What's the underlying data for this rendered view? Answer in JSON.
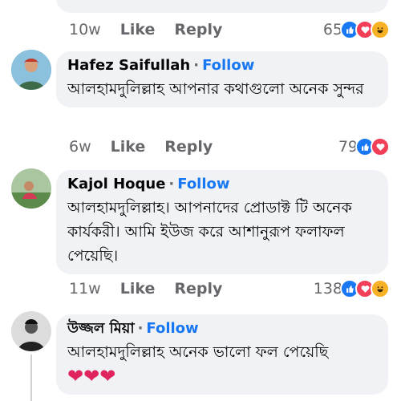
{
  "comments": [
    {
      "time": "10w",
      "like": "Like",
      "reply": "Reply",
      "count": "65"
    },
    {
      "author": "Hafez Saifullah",
      "follow": "Follow",
      "text": "আলহামদুলিল্লাহ আপনার কথাগুলো অনেক সুন্দর",
      "time": "6w",
      "like": "Like",
      "reply": "Reply",
      "count": "79"
    },
    {
      "author": "Kajol Hoque",
      "follow": "Follow",
      "text": "আলহামদুলিল্লাহ। আপনাদের প্রোডাক্ট টি অনেক কার্যকরী। আমি ইউজ করে আশানুরূপ ফলাফল পেয়েছি।",
      "time": "11w",
      "like": "Like",
      "reply": "Reply",
      "count": "138"
    },
    {
      "author": "উজ্জল মিয়া",
      "follow": "Follow",
      "text": "আলহামদুলিল্লাহ অনেক ভালো ফল পেয়েছি",
      "emoji": "❤❤❤"
    }
  ],
  "colors": {
    "link": "#1877f2",
    "meta": "#65676b",
    "bubble": "#f0f2f5"
  }
}
